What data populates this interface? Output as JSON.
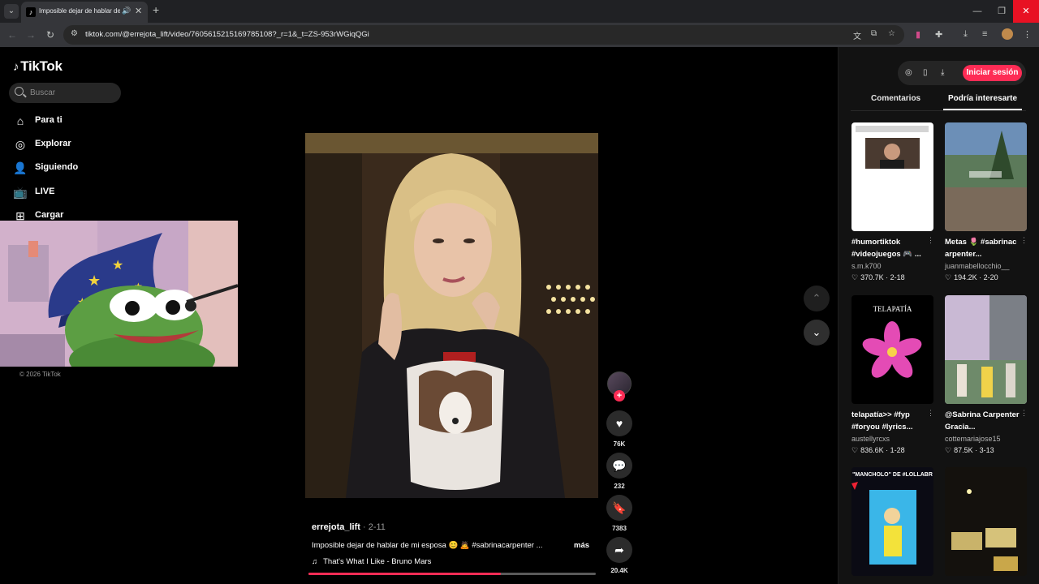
{
  "browser": {
    "tab_title": "Imposible dejar de hablar de mi esposa",
    "url": "tiktok.com/@errejota_lift/video/7605615215169785108?_r=1&_t=ZS-953rWGiqQGi"
  },
  "sidebar": {
    "logo_text": "TikTok",
    "search_placeholder": "Buscar",
    "nav": [
      {
        "label": "Para ti",
        "icon": "home-icon"
      },
      {
        "label": "Explorar",
        "icon": "compass-icon"
      },
      {
        "label": "Siguiendo",
        "icon": "person-follow-icon"
      },
      {
        "label": "LIVE",
        "icon": "live-tv-icon"
      },
      {
        "label": "Cargar",
        "icon": "upload-plus-icon"
      }
    ],
    "copyright": "© 2026 TikTok"
  },
  "video": {
    "author": "errejota_lift",
    "date": " · 2-11",
    "description": "Imposible dejar de hablar de mi esposa 😊 🙇 #sabrinacarpenter ...",
    "more_label": "más",
    "music": "That's What I Like - Bruno Mars",
    "progress_fraction": 0.67,
    "likes": "76K",
    "comments": "232",
    "saves": "7383",
    "shares": "20.4K"
  },
  "right_panel": {
    "login_label": "Iniciar sesión",
    "tabs": [
      "Comentarios",
      "Podría interesarte"
    ],
    "active_tab": 1,
    "cards": [
      {
        "title": "#humortiktok #videojuegos 🎮 ...",
        "author": "s.m.k700",
        "likes": "370.7K",
        "date": "2-18"
      },
      {
        "title": "Metas 🌷 #sabrinac arpenter...",
        "author": "juanmabellocchio__",
        "likes": "194.2K",
        "date": "2-20"
      },
      {
        "title": "telapatía>> #fyp #foryou #lyrics...",
        "author": "austellyrcxs",
        "likes": "836.6K",
        "date": "1-28"
      },
      {
        "title": "@Sabrina Carpenter Gracia...",
        "author": "cottemariajose15",
        "likes": "87.5K",
        "date": "3-13"
      },
      {
        "title": "",
        "author": "",
        "likes": "",
        "date": ""
      },
      {
        "title": "",
        "author": "",
        "likes": "",
        "date": ""
      }
    ],
    "thumb_texts": {
      "telapatia": "TELAPATÍA",
      "mancholo": "\"MANCHOLO\" DE #LOLLABR"
    }
  },
  "colors": {
    "accent": "#fe2c55",
    "panel": "#121212"
  }
}
